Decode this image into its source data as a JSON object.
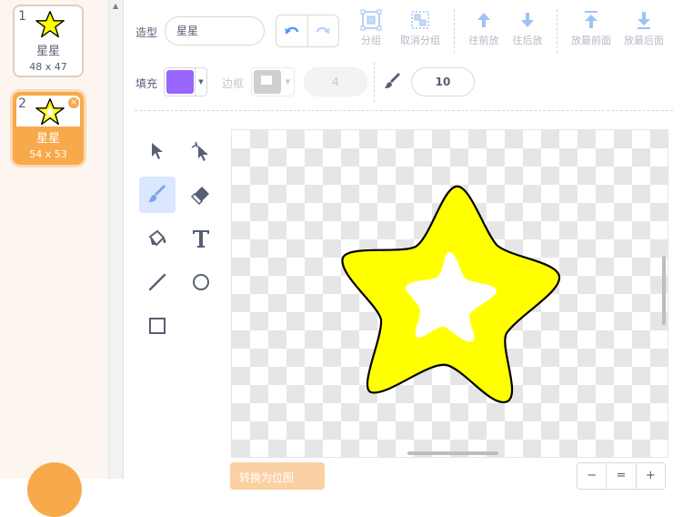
{
  "costumes": [
    {
      "number": "1",
      "name": "星星",
      "size": "48 x 47",
      "selected": false
    },
    {
      "number": "2",
      "name": "星星",
      "size": "54 x 53",
      "selected": true
    }
  ],
  "toolbar": {
    "costume_label": "造型",
    "costume_name": "星星",
    "group_label": "分组",
    "ungroup_label": "取消分组",
    "forward_label": "往前放",
    "backward_label": "往后放",
    "front_label": "放最前面",
    "back_label": "放最后面"
  },
  "properties": {
    "fill_label": "填充",
    "fill_color": "#9966ff",
    "outline_label": "边框",
    "outline_width": "4",
    "brush_size": "10"
  },
  "canvas": {
    "star_fill": "#ffff00",
    "star_inner": "#ffffff",
    "star_stroke": "#000000"
  },
  "footer": {
    "convert_label": "转换为位图",
    "zoom_out": "−",
    "zoom_reset": "=",
    "zoom_in": "+"
  },
  "colors": {
    "accent": "#f7a94b",
    "tool_active": "#dbe6ff",
    "icon_blue": "#4c97ff"
  }
}
